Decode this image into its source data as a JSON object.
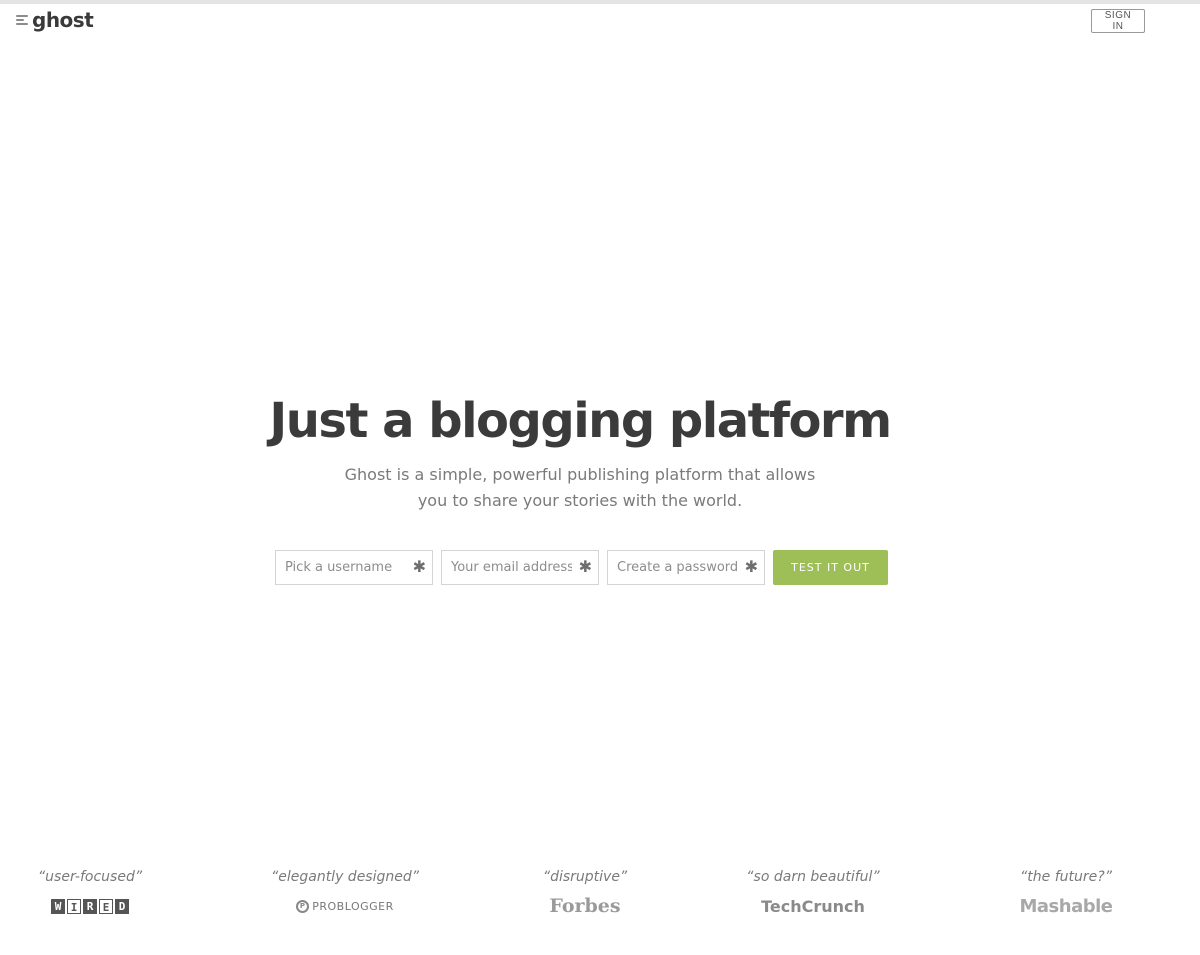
{
  "header": {
    "logo_text": "ghost",
    "logo_icon": "ghost-lines-icon",
    "sign_in_label": "SIGN IN"
  },
  "hero": {
    "title": "Just a blogging platform",
    "subtitle_line1": "Ghost is a simple, powerful publishing platform that allows",
    "subtitle_line2": "you to share your stories with the world."
  },
  "signup_form": {
    "username_placeholder": "Pick a username",
    "email_placeholder": "Your email address",
    "password_placeholder": "Create a password",
    "required_marker": "✱",
    "submit_label": "TEST IT OUT"
  },
  "press": [
    {
      "quote": "“user-focused”",
      "outlet": "WIRED"
    },
    {
      "quote": "“elegantly designed”",
      "outlet": "PROBLOGGER"
    },
    {
      "quote": "“disruptive”",
      "outlet": "Forbes"
    },
    {
      "quote": "“so darn beautiful”",
      "outlet": "TechCrunch"
    },
    {
      "quote": "“the future?”",
      "outlet": "Mashable"
    }
  ],
  "colors": {
    "accent_green": "#9ebf57",
    "title_text": "#3b3b3b",
    "muted_text": "#7a7a7a",
    "border": "#d5d5d5"
  }
}
